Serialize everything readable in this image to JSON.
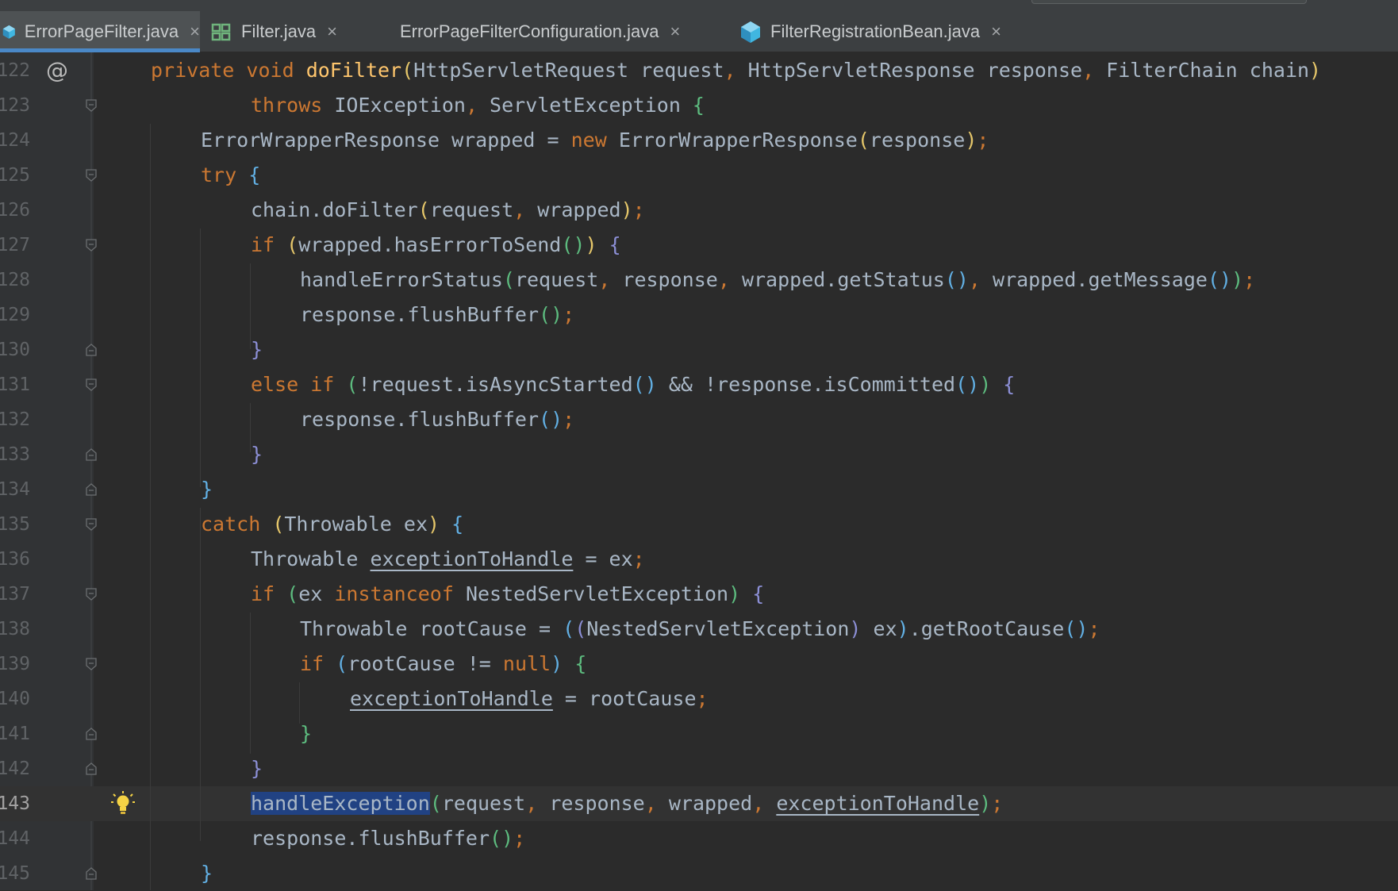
{
  "tabs": [
    {
      "label": "ErrorPageFilter.java",
      "icon": "java-class-icon",
      "active": true
    },
    {
      "label": "Filter.java",
      "icon": "java-interface-icon",
      "active": false
    },
    {
      "label": "ErrorPageFilterConfiguration.java",
      "icon": "java-class-icon",
      "active": false
    },
    {
      "label": "FilterRegistrationBean.java",
      "icon": "java-class-icon",
      "active": false
    }
  ],
  "tab_close_glyph": "×",
  "gutter": {
    "line_numbers": [
      "122",
      "123",
      "124",
      "125",
      "126",
      "127",
      "128",
      "129",
      "130",
      "131",
      "132",
      "133",
      "134",
      "135",
      "136",
      "137",
      "138",
      "139",
      "140",
      "141",
      "142",
      "143",
      "144",
      "145"
    ],
    "override_marker": "@",
    "current_line": "143"
  },
  "code": {
    "l122": {
      "a": "private ",
      "b": "void ",
      "c": "doFilter",
      "d": "(",
      "e": "HttpServletRequest request",
      ",": ", ",
      "f": "HttpServletResponse response",
      "g": ", ",
      "h": "FilterChain chain",
      "i": ")"
    },
    "l123": {
      "a": "throws ",
      "b": "IOException",
      "c": ", ",
      "d": "ServletException ",
      "e": "{"
    },
    "l124": {
      "a": "ErrorWrapperResponse wrapped = ",
      "b": "new ",
      "c": "ErrorWrapperResponse",
      "d": "(",
      "e": "response",
      "f": ")",
      "g": ";"
    },
    "l125": {
      "a": "try ",
      "b": "{"
    },
    "l126": {
      "a": "chain.doFilter",
      "b": "(",
      "c": "request",
      ",": ", ",
      "d": "wrapped",
      "e": ")",
      "f": ";"
    },
    "l127": {
      "a": "if ",
      "b": "(",
      "c": "wrapped.hasErrorToSend",
      "d": "()",
      "e": ") ",
      "f": "{"
    },
    "l128": {
      "a": "handleErrorStatus",
      "b": "(",
      "c": "request",
      ",": ", ",
      "d": "response",
      "e": ", ",
      "f": "wrapped.getStatus",
      "g": "()",
      "h": ", ",
      "i": "wrapped.getMessage",
      "j": "()",
      "k": ")",
      "l": ";"
    },
    "l129": {
      "a": "response.flushBuffer",
      "b": "()",
      "c": ";"
    },
    "l130": {
      "a": "}"
    },
    "l131": {
      "a": "else if ",
      "b": "(",
      "c": "!request.isAsyncStarted",
      "d": "()",
      "e": " && !response.isCommitted",
      "f": "()",
      "g": ") ",
      "h": "{"
    },
    "l132": {
      "a": "response.flushBuffer",
      "b": "()",
      "c": ";"
    },
    "l133": {
      "a": "}"
    },
    "l134": {
      "a": "}"
    },
    "l135": {
      "a": "catch ",
      "b": "(",
      "c": "Throwable ex",
      "d": ") ",
      "e": "{"
    },
    "l136": {
      "a": "Throwable ",
      "b": "exceptionToHandle",
      "c": " = ex",
      "d": ";"
    },
    "l137": {
      "a": "if ",
      "b": "(",
      "c": "ex ",
      "d": "instanceof ",
      "e": "NestedServletException",
      "f": ") ",
      "g": "{"
    },
    "l138": {
      "a": "Throwable rootCause = ",
      "b": "(",
      "c": "(",
      "d": "NestedServletException",
      "e": ")",
      "f": " ex",
      "g": ")",
      "h": ".getRootCause",
      "i": "()",
      "j": ";"
    },
    "l139": {
      "a": "if ",
      "b": "(",
      "c": "rootCause != ",
      "d": "null",
      "e": ") ",
      "f": "{"
    },
    "l140": {
      "a": "exceptionToHandle",
      "b": " = rootCause",
      "c": ";"
    },
    "l141": {
      "a": "}"
    },
    "l142": {
      "a": "}"
    },
    "l143": {
      "a": "handleException",
      "b": "(",
      "c": "request",
      ",": ", ",
      "d": "response",
      "e": ", ",
      "f": "wrapped",
      "g": ", ",
      "h": "exceptionToHandle",
      "i": ")",
      "j": ";"
    },
    "l144": {
      "a": "response.flushBuffer",
      "b": "()",
      "c": ";"
    },
    "l145": {
      "a": "}"
    }
  },
  "colors": {
    "background": "#2b2b2b",
    "keyword": "#cc7832",
    "method_decl": "#ffc66d",
    "identifier": "#a9b7c6",
    "selection": "#214283",
    "tab_underline": "#4a88c7"
  }
}
